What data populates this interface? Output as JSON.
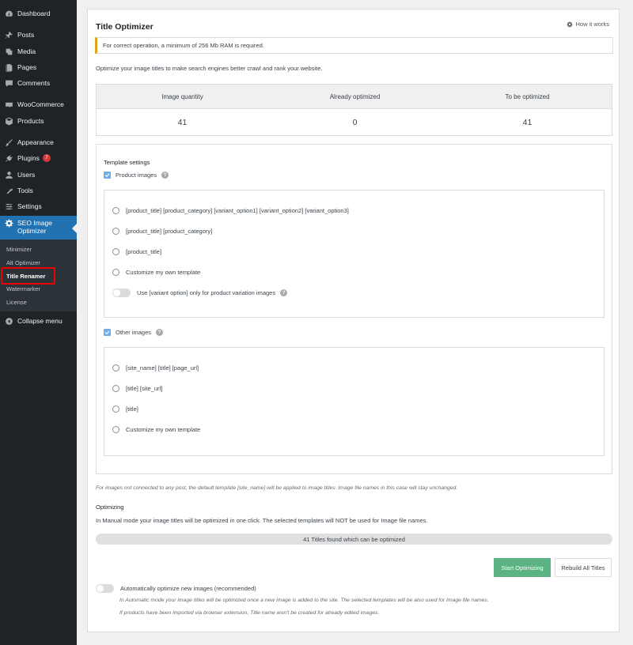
{
  "sidebar": {
    "items": [
      {
        "label": "Dashboard",
        "icon": "dashboard-icon"
      },
      {
        "label": "Posts",
        "icon": "pin-icon"
      },
      {
        "label": "Media",
        "icon": "media-icon"
      },
      {
        "label": "Pages",
        "icon": "pages-icon"
      },
      {
        "label": "Comments",
        "icon": "comment-icon"
      },
      {
        "label": "WooCommerce",
        "icon": "woocommerce-icon"
      },
      {
        "label": "Products",
        "icon": "box-icon"
      },
      {
        "label": "Appearance",
        "icon": "brush-icon"
      },
      {
        "label": "Plugins",
        "icon": "plug-icon",
        "badge": "7"
      },
      {
        "label": "Users",
        "icon": "user-icon"
      },
      {
        "label": "Tools",
        "icon": "wrench-icon"
      },
      {
        "label": "Settings",
        "icon": "settings-icon"
      },
      {
        "label": "SEO Image Optimizer",
        "icon": "gear-icon",
        "active": true
      }
    ],
    "submenu": [
      "Minimizer",
      "Alt Optimizer",
      "Title Renamer",
      "Watermarker",
      "License"
    ],
    "current_submenu": "Title Renamer",
    "collapse_label": "Collapse menu",
    "colors": {
      "bg": "#1d2327",
      "active": "#2271b1",
      "highlight": "#e00000"
    }
  },
  "panel": {
    "title": "Title Optimizer",
    "how_it_works": "How it works",
    "notice": "For correct operation, a minimum of 256 Mb RAM is required.",
    "description": "Optimize your image titles to make search engines better crawl and rank your website."
  },
  "stats": {
    "headers": [
      "Image quantity",
      "Already optimized",
      "To be optimized"
    ],
    "values": [
      "41",
      "0",
      "41"
    ]
  },
  "template_settings": {
    "title": "Template settings",
    "product_images": {
      "label": "Product images",
      "checked": true,
      "options": [
        "[product_title] [product_category] [variant_option1] [variant_option2] [variant_option3]",
        "[product_title] [product_category]",
        "[product_title]",
        "Customize my own template"
      ],
      "toggle_label": "Use [variant option] only for product variation images"
    },
    "other_images": {
      "label": "Other images",
      "checked": true,
      "options": [
        "[site_name] [title] [page_url]",
        "[title] [site_url]",
        "[title]",
        "Customize my own template"
      ]
    }
  },
  "note": "For images not connected to any post, the default template [site_name] will be applied to image titles. Image file names in this case will stay unchanged.",
  "optimizing": {
    "title": "Optimizing",
    "description": "In Manual mode your image titles will be optimized in one click. The selected templates will NOT be used for Image file names.",
    "progress_text": "41 Titles found which can be optimized",
    "progress_value": 0,
    "start_button": "Start Optimizing",
    "rebuild_button": "Rebuild All Titles",
    "auto_label": "Automatically optimize new images (recommended)",
    "auto_note_1": "In Automatic mode your image titles will be optimized once a new image is added to the site. The selected templates will be also used for Image file names.",
    "auto_note_2": "If products have been imported via browser extension, Title name won't be created for already edited images."
  }
}
